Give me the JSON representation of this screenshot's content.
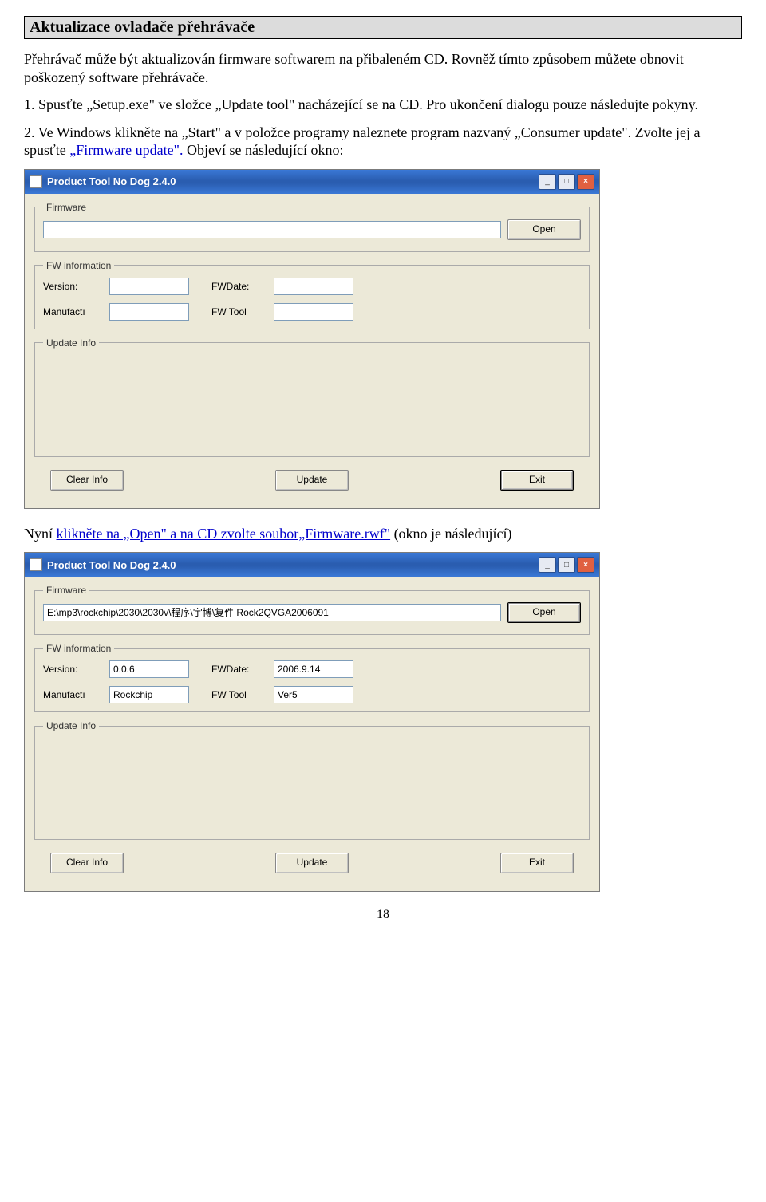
{
  "section_title": "Aktualizace ovladače přehrávače",
  "intro": "Přehrávač může být aktualizován firmware softwarem na přibaleném CD. Rovněž tímto způsobem můžete obnovit poškozený software přehrávače.",
  "step1": "1. Spusťte „Setup.exe\" ve složce „Update tool\" nacházející se na CD. Pro ukončení dialogu pouze následujte pokyny.",
  "step2_prefix": "2. Ve Windows klikněte na „Start\" a v položce programy naleznete program nazvaný „Consumer update\". Zvolte jej a spusťte ",
  "step2_link": "„Firmware update\".",
  "step2_suffix": " Objeví se následující okno:",
  "dialog1": {
    "title": "Product Tool No Dog 2.4.0",
    "firmware_legend": "Firmware",
    "firmware_value": "",
    "open_btn": "Open",
    "fw_info_legend": "FW information",
    "version_label": "Version:",
    "version_value": "",
    "fwdate_label": "FWDate:",
    "fwdate_value": "",
    "manufact_label": "Manufactı",
    "manufact_value": "",
    "fwtool_label": "FW Tool",
    "fwtool_value": "",
    "update_info_legend": "Update Info",
    "clear_btn": "Clear Info",
    "update_btn": "Update",
    "exit_btn": "Exit"
  },
  "mid_text_prefix": "Nyní ",
  "mid_text_link": "klikněte na „Open\" a na CD zvolte soubor„Firmware.rwf\"",
  "mid_text_suffix": " (okno je následující)",
  "dialog2": {
    "title": "Product Tool No Dog 2.4.0",
    "firmware_legend": "Firmware",
    "firmware_value": "E:\\mp3\\rockchip\\2030\\2030v\\程序\\宇博\\复件 Rock2QVGA2006091",
    "open_btn": "Open",
    "fw_info_legend": "FW information",
    "version_label": "Version:",
    "version_value": "0.0.6",
    "fwdate_label": "FWDate:",
    "fwdate_value": "2006.9.14",
    "manufact_label": "Manufactı",
    "manufact_value": "Rockchip",
    "fwtool_label": "FW Tool",
    "fwtool_value": "Ver5",
    "update_info_legend": "Update Info",
    "clear_btn": "Clear Info",
    "update_btn": "Update",
    "exit_btn": "Exit"
  },
  "page_number": "18"
}
